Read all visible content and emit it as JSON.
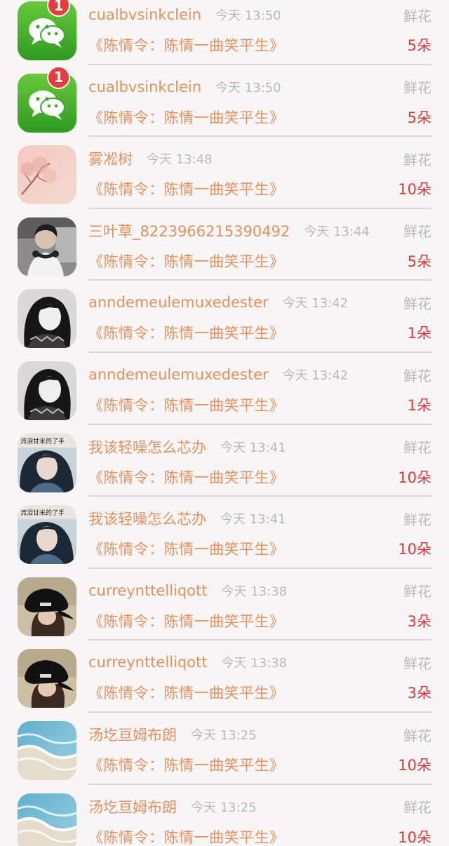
{
  "labels": {
    "time_prefix": "今天",
    "gift_type": "鲜花",
    "show_title": "《陈情令：陈情一曲笑平生》"
  },
  "colors": {
    "name": "#e3925f",
    "time": "#b9b9b9",
    "amount": "#d33a3a",
    "badge": "#f0393a"
  },
  "items": [
    {
      "name": "cualbvsinkclein",
      "time": "今天 13:50",
      "gift": "鲜花",
      "show": "《陈情令：陈情一曲笑平生》",
      "amount": "5朵",
      "avatar": "wechat-logo",
      "badge": "1"
    },
    {
      "name": "cualbvsinkclein",
      "time": "今天 13:50",
      "gift": "鲜花",
      "show": "《陈情令：陈情一曲笑平生》",
      "amount": "5朵",
      "avatar": "wechat-logo",
      "badge": "1"
    },
    {
      "name": "雾凇树",
      "time": "今天 13:48",
      "gift": "鲜花",
      "show": "《陈情令：陈情一曲笑平生》",
      "amount": "10朵",
      "avatar": "pink-tree"
    },
    {
      "name": "三叶草_8223966215390492",
      "time": "今天 13:44",
      "gift": "鲜花",
      "show": "《陈情令：陈情一曲笑平生》",
      "amount": "5朵",
      "avatar": "boy-headphones"
    },
    {
      "name": "anndemeulemuxedester",
      "time": "今天 13:42",
      "gift": "鲜花",
      "show": "《陈情令：陈情一曲笑平生》",
      "amount": "1朵",
      "avatar": "girl-bw"
    },
    {
      "name": "anndemeulemuxedester",
      "time": "今天 13:42",
      "gift": "鲜花",
      "show": "《陈情令：陈情一曲笑平生》",
      "amount": "1朵",
      "avatar": "girl-bw"
    },
    {
      "name": "我该轻噪怎么芯办",
      "time": "今天 13:41",
      "gift": "鲜花",
      "show": "《陈情令：陈情一曲笑平生》",
      "amount": "10朵",
      "avatar": "girl-blue"
    },
    {
      "name": "我该轻噪怎么芯办",
      "time": "今天 13:41",
      "gift": "鲜花",
      "show": "《陈情令：陈情一曲笑平生》",
      "amount": "10朵",
      "avatar": "girl-blue"
    },
    {
      "name": "curreynttelliqott",
      "time": "今天 13:38",
      "gift": "鲜花",
      "show": "《陈情令：陈情一曲笑平生》",
      "amount": "3朵",
      "avatar": "black-cap"
    },
    {
      "name": "curreynttelliqott",
      "time": "今天 13:38",
      "gift": "鲜花",
      "show": "《陈情令：陈情一曲笑平生》",
      "amount": "3朵",
      "avatar": "black-cap"
    },
    {
      "name": "汤圪亘姆布朗",
      "time": "今天 13:25",
      "gift": "鲜花",
      "show": "《陈情令：陈情一曲笑平生》",
      "amount": "10朵",
      "avatar": "sea-waves"
    },
    {
      "name": "汤圪亘姆布朗",
      "time": "今天 13:25",
      "gift": "鲜花",
      "show": "《陈情令：陈情一曲笑平生》",
      "amount": "10朵",
      "avatar": "sea-waves"
    }
  ]
}
